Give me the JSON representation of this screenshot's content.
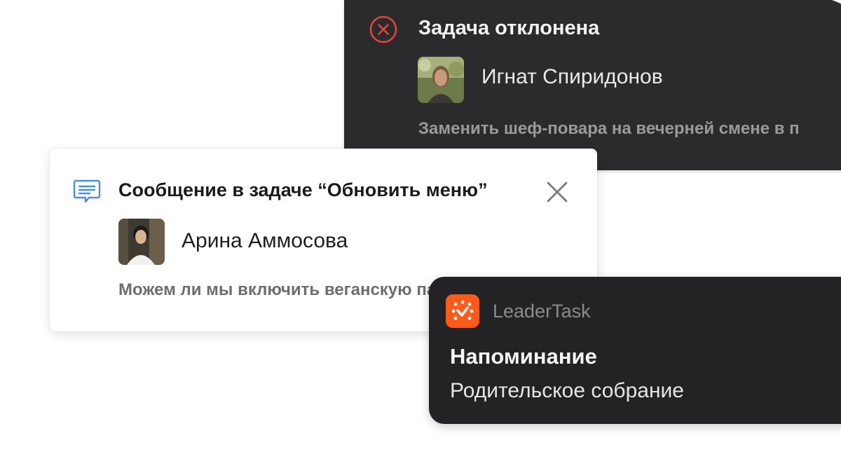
{
  "rejected_notification": {
    "icon": "close-circle-icon",
    "title": "Задача отклонена",
    "user_name": "Игнат Спиридонов",
    "body": "Заменить шеф-повара на вечерней смене в п",
    "accent_color": "#e2453c"
  },
  "message_notification": {
    "icon": "chat-message-icon",
    "title": "Сообщение в задаче “Обновить меню”",
    "user_name": "Арина Аммосова",
    "body": "Можем ли мы включить веганскую пасту?",
    "close_icon": "close-icon",
    "accent_color": "#4a90d9"
  },
  "reminder_notification": {
    "app_name": "LeaderTask",
    "app_icon": "leadertask-logo-icon",
    "title": "Напоминание",
    "body": "Родительское собрание",
    "accent_color": "#ff5a1a"
  }
}
